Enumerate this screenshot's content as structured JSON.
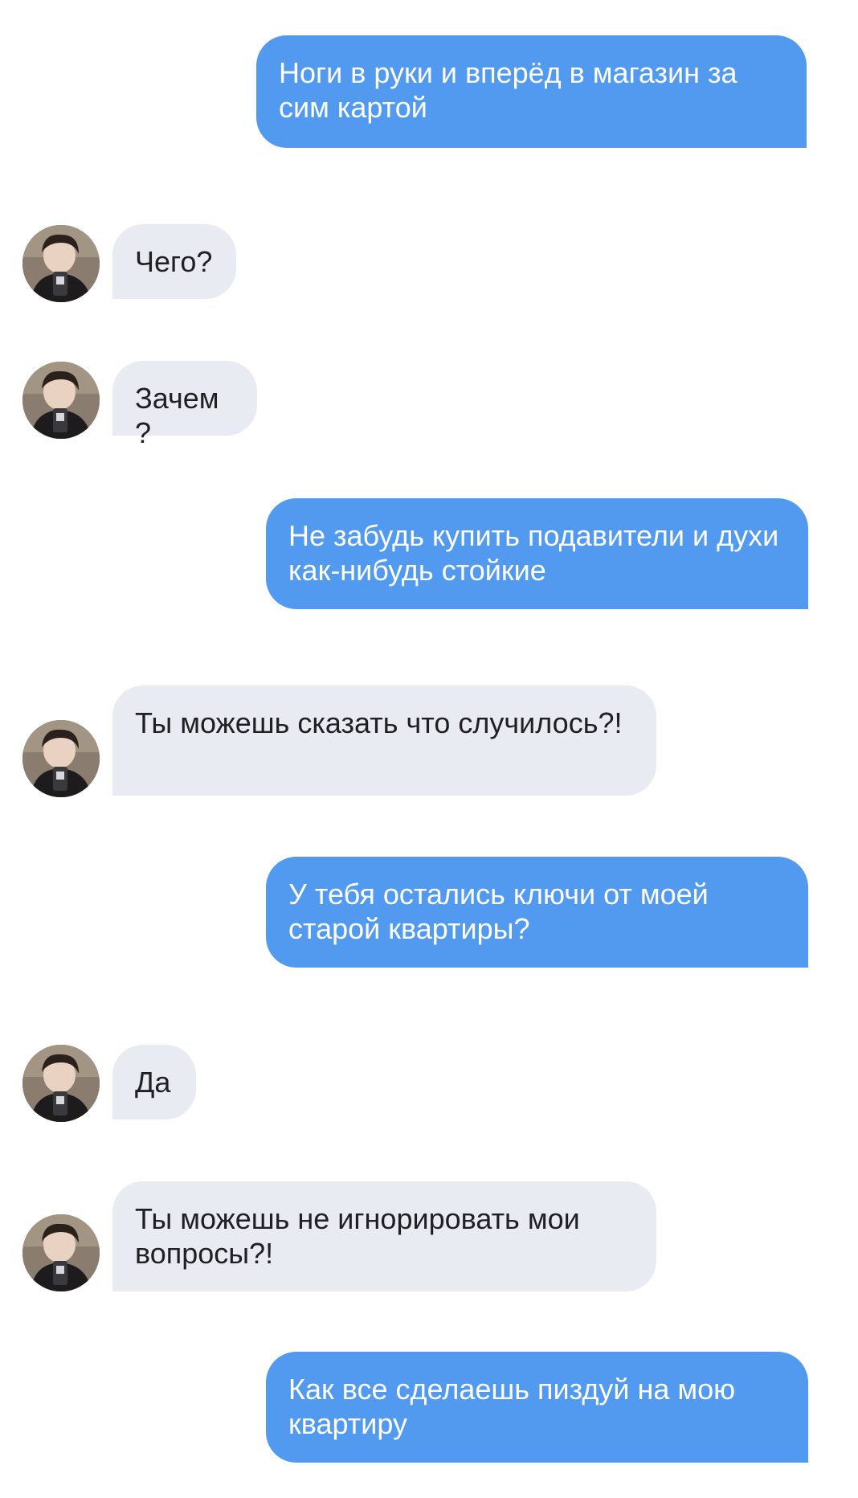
{
  "chat": {
    "messages": [
      {
        "side": "out",
        "text": "Ноги в руки и вперёд в магазин за сим картой"
      },
      {
        "side": "in",
        "text": "Чего?"
      },
      {
        "side": "in",
        "text": "Зачем?"
      },
      {
        "side": "out",
        "text": "Не забудь купить подавители и духи как-нибудь стойкие"
      },
      {
        "side": "in",
        "text": "Ты можешь сказать что случилось?!"
      },
      {
        "side": "out",
        "text": "У тебя остались ключи от моей старой квартиры?"
      },
      {
        "side": "in",
        "text": "Да"
      },
      {
        "side": "in",
        "text": "Ты можешь не игнорировать мои вопросы?!"
      },
      {
        "side": "out",
        "text": "Как все сделаешь пиздуй на мою квартиру"
      }
    ]
  },
  "colors": {
    "outgoing_bubble": "#529af0",
    "incoming_bubble": "#e8ebf2",
    "outgoing_text": "#ffffff",
    "incoming_text": "#1f1f24",
    "background": "#ffffff"
  },
  "icons": {
    "avatar": "contact-avatar-photo"
  }
}
